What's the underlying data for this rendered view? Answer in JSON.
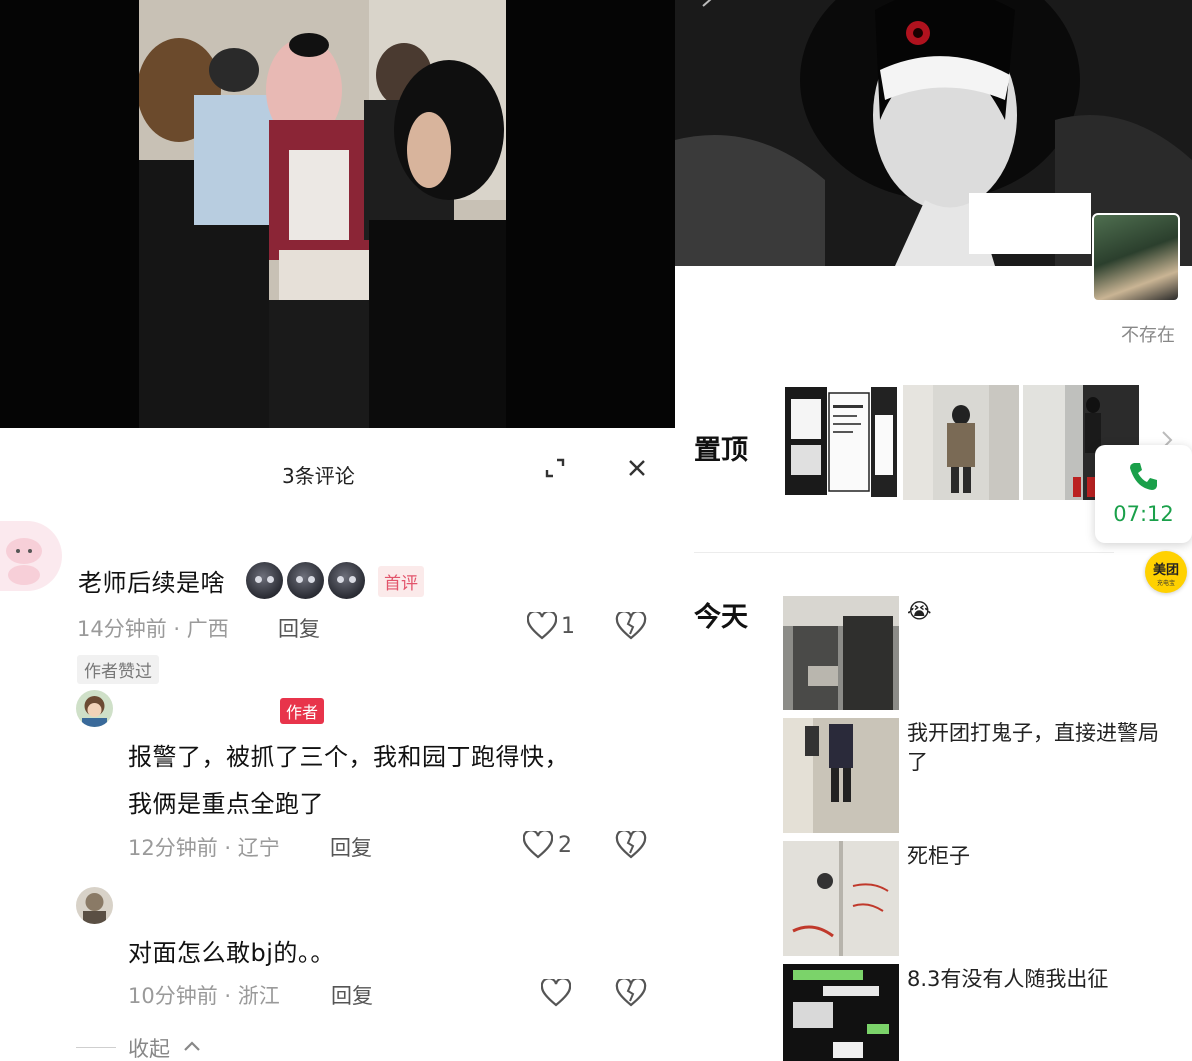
{
  "comments_panel": {
    "title": "3条评论",
    "expand_icon": "expand-icon",
    "close_icon": "close-icon",
    "comments": [
      {
        "text": "老师后续是啥",
        "emoji": [
          "dark-face-emoji",
          "dark-face-emoji",
          "dark-face-emoji"
        ],
        "badge": "首评",
        "time_location": "14分钟前 · 广西",
        "reply_label": "回复",
        "likes": "1",
        "author_liked": "作者赞过"
      },
      {
        "author_badge": "作者",
        "text_line1": "报警了，被抓了三个，我和园丁跑得快，",
        "text_line2": "我俩是重点全跑了",
        "time_location": "12分钟前 · 辽宁",
        "reply_label": "回复",
        "likes": "2"
      },
      {
        "text": "对面怎么敢bj的。。",
        "time_location": "10分钟前 · 浙江",
        "reply_label": "回复",
        "likes": ""
      }
    ],
    "collapse_label": "收起"
  },
  "profile_panel": {
    "status_text": "不存在",
    "pinned_title": "置顶",
    "today_title": "今天",
    "call": {
      "time": "07:12"
    },
    "meituan": {
      "label": "美团",
      "sub": "充电宝"
    },
    "posts": [
      {
        "text": "😭"
      },
      {
        "text": "我开团打鬼子，直接进警局了"
      },
      {
        "text": "死柜子"
      },
      {
        "text": "8.3有没有人随我出征"
      }
    ]
  }
}
